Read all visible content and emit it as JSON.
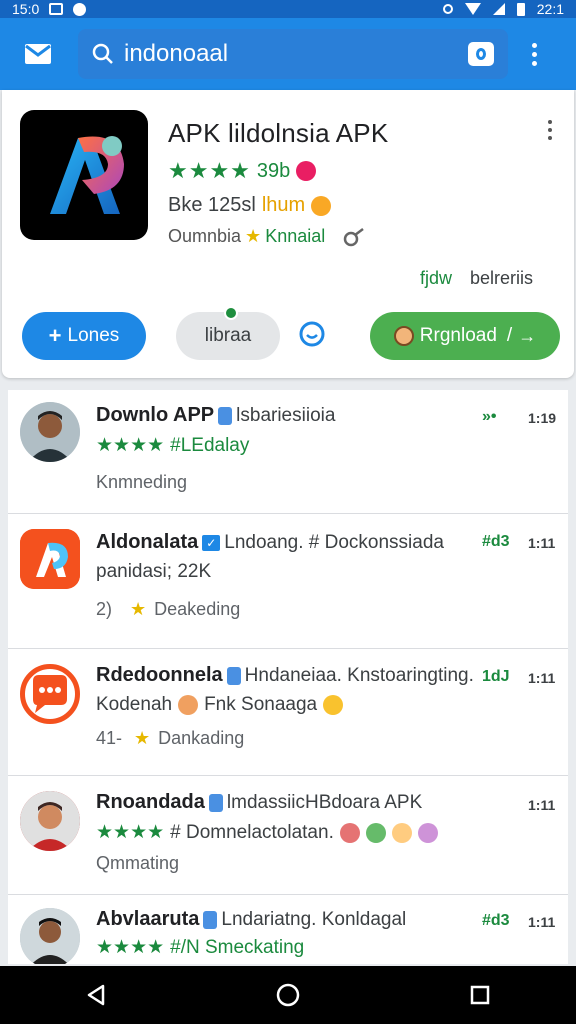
{
  "status_bar": {
    "time_left": "15:0",
    "time_right": "22:1"
  },
  "search": {
    "query": "indonoaal"
  },
  "hero": {
    "title": "APK lildolnsia APK",
    "rating_text": "39b",
    "line2_text": "Bke 125sl",
    "line2_highlight": "lhum",
    "line3_text": "Oumnbia",
    "line3_highlight": "Knnaial",
    "meta_left": "fjdw",
    "meta_right": "belreriis",
    "btn_lones": "Lones",
    "btn_libraa": "libraa",
    "btn_download": "Rrgnload"
  },
  "list": [
    {
      "title": "Downlo APP",
      "subtitle": "lsbariesiioia",
      "line2": "#LEdalay",
      "line3": "Knmneding",
      "meta_g": "»•",
      "meta_n": "1:19"
    },
    {
      "title": "Aldonalata",
      "subtitle": "Lndoang. # Dockonssiada",
      "line2": "panidasi; 22K",
      "line3_num": "2)",
      "line3": "Deakeding",
      "meta_g": "#d3",
      "meta_n": "1:11"
    },
    {
      "title": "Rdedoonnela",
      "subtitle": "Hndaneiaa. Knstoaringting.",
      "line2": "Kodenah",
      "line2_b": "Fnk Sonaaga",
      "line3_num": "41-",
      "line3": "Dankading",
      "meta_g": "1dJ",
      "meta_n": "1:11"
    },
    {
      "title": "Rnoandada",
      "subtitle": "lmdassiicHBdoara APK",
      "line2": "# Domnelactolatan.",
      "line3": "Qmmating",
      "meta_n": "1:11"
    },
    {
      "title": "Abvlaaruta",
      "subtitle": "Lndariatng. Konldagal",
      "line2": "#/N Smeckating",
      "meta_g": "#d3",
      "meta_n": "1:11"
    }
  ],
  "colors": {
    "app_bar": "#1e88e5",
    "status_bar": "#1565c0",
    "download_button": "#4caf50",
    "rating_green": "#1b8a3e"
  },
  "icons": [
    "mail-icon",
    "search-icon",
    "lens-icon",
    "more-vert-icon",
    "chat-icon",
    "back-icon",
    "home-icon",
    "recents-icon"
  ]
}
